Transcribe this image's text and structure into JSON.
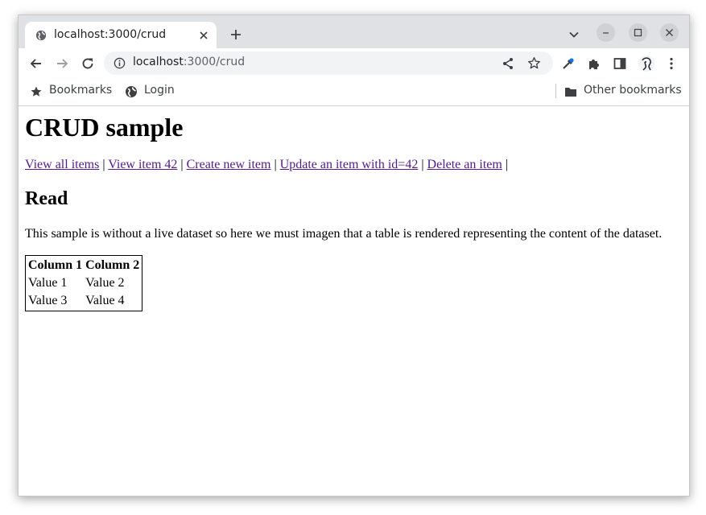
{
  "browser": {
    "tab_title": "localhost:3000/crud",
    "url_host": "localhost",
    "url_path": ":3000/crud",
    "bookmarks": {
      "bookmarks_label": "Bookmarks",
      "login_label": "Login",
      "other_label": "Other bookmarks"
    },
    "icons": [
      "globe-icon",
      "close-icon",
      "plus-icon",
      "chevron-down-icon",
      "minimize-icon",
      "maximize-icon",
      "close-icon",
      "back-arrow-icon",
      "forward-arrow-icon",
      "reload-icon",
      "info-icon",
      "share-icon",
      "star-icon",
      "eyedropper-icon",
      "puzzle-icon",
      "side-panel-icon",
      "avatar",
      "kebab-menu-icon",
      "folder-icon"
    ]
  },
  "page": {
    "title": "CRUD sample",
    "nav": [
      {
        "label": "View all items"
      },
      {
        "label": "View item 42"
      },
      {
        "label": "Create new item"
      },
      {
        "label": "Update an item with id=42"
      },
      {
        "label": "Delete an item"
      }
    ],
    "separator": "|",
    "section_heading": "Read",
    "description": "This sample is without a live dataset so here we must imagen that a table is rendered representing the content of the dataset.",
    "table": {
      "headers": [
        "Column 1",
        "Column 2"
      ],
      "rows": [
        [
          "Value 1",
          "Value 2"
        ],
        [
          "Value 3",
          "Value 4"
        ]
      ]
    },
    "colors": {
      "link_visited": "#551a8b",
      "tabstrip": "#dfe1e5",
      "omnibox": "#f1f3f4"
    }
  }
}
